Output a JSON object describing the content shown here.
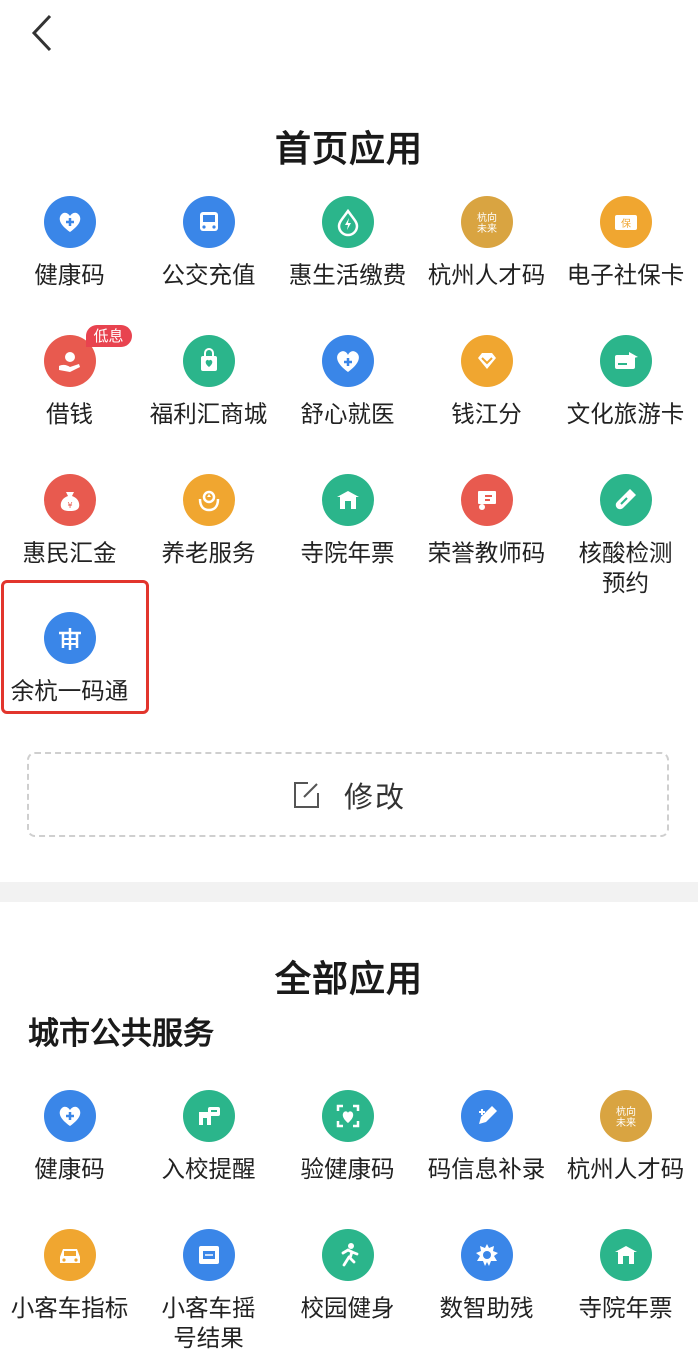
{
  "home": {
    "title": "首页应用",
    "apps": [
      {
        "label": "健康码",
        "icon": "heart-plus-icon",
        "color": "#3a86e8"
      },
      {
        "label": "公交充值",
        "icon": "bus-icon",
        "color": "#3a86e8"
      },
      {
        "label": "惠生活缴费",
        "icon": "bolt-drop-icon",
        "color": "#2bb58b"
      },
      {
        "label": "杭州人才码",
        "icon": "hangzhou-talent-logo-icon",
        "color": "#d9a441"
      },
      {
        "label": "电子社保卡",
        "icon": "social-security-card-icon",
        "color": "#f0a630"
      },
      {
        "label": "借钱",
        "icon": "hand-coin-icon",
        "color": "#e85a4f",
        "badge": "低息"
      },
      {
        "label": "福利汇商城",
        "icon": "shopping-bag-icon",
        "color": "#2bb58b"
      },
      {
        "label": "舒心就医",
        "icon": "medical-heart-icon",
        "color": "#3a86e8"
      },
      {
        "label": "钱江分",
        "icon": "diamond-icon",
        "color": "#f0a630"
      },
      {
        "label": "文化旅游卡",
        "icon": "travel-card-icon",
        "color": "#2bb58b"
      },
      {
        "label": "惠民汇金",
        "icon": "money-bag-icon",
        "color": "#e85a4f"
      },
      {
        "label": "养老服务",
        "icon": "elderly-care-icon",
        "color": "#f0a630"
      },
      {
        "label": "寺院年票",
        "icon": "temple-icon",
        "color": "#2bb58b"
      },
      {
        "label": "荣誉教师码",
        "icon": "teacher-board-icon",
        "color": "#e85a4f"
      },
      {
        "label": "核酸检测预约",
        "icon": "test-tube-icon",
        "color": "#2bb58b"
      },
      {
        "label": "余杭一码通",
        "icon": "yuhang-logo-icon",
        "color": "#3a86e8"
      }
    ],
    "edit_label": "修改"
  },
  "all": {
    "title": "全部应用",
    "group_title": "城市公共服务",
    "apps": [
      {
        "label": "健康码",
        "icon": "heart-plus-icon",
        "color": "#3a86e8"
      },
      {
        "label": "入校提醒",
        "icon": "school-notice-icon",
        "color": "#2bb58b"
      },
      {
        "label": "验健康码",
        "icon": "scan-heart-icon",
        "color": "#2bb58b"
      },
      {
        "label": "码信息补录",
        "icon": "edit-pen-icon",
        "color": "#3a86e8"
      },
      {
        "label": "杭州人才码",
        "icon": "hangzhou-talent-logo-icon",
        "color": "#d9a441"
      },
      {
        "label": "小客车指标",
        "icon": "car-icon",
        "color": "#f0a630"
      },
      {
        "label": "小客车摇号结果",
        "icon": "lottery-result-icon",
        "color": "#3a86e8"
      },
      {
        "label": "校园健身",
        "icon": "running-icon",
        "color": "#2bb58b"
      },
      {
        "label": "数智助残",
        "icon": "disability-aid-icon",
        "color": "#3a86e8"
      },
      {
        "label": "寺院年票",
        "icon": "temple-icon",
        "color": "#2bb58b"
      }
    ]
  }
}
